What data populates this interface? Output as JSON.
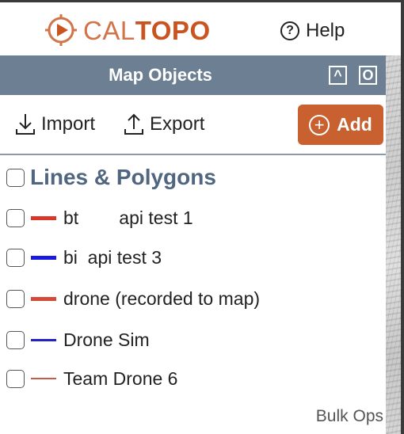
{
  "brand": {
    "logo_part1": "CAL",
    "logo_part2": "TOPO",
    "color_light": "#d2744a",
    "color_dark": "#c9541f"
  },
  "header": {
    "help_icon": "?",
    "help_label": "Help"
  },
  "panel": {
    "title": "Map Objects",
    "collapse_icon": "^",
    "popout_icon": "O"
  },
  "toolbar": {
    "import_label": "Import",
    "export_label": "Export",
    "add_icon": "+",
    "add_label": "Add",
    "add_color": "#c8612f"
  },
  "section": {
    "label": "Lines & Polygons"
  },
  "items": [
    {
      "label": "bt        api test 1",
      "color": "#d9372a",
      "weight": "thick"
    },
    {
      "label": "bi  api test 3",
      "color": "#1a1ae0",
      "weight": "thick"
    },
    {
      "label": "drone (recorded to map)",
      "color": "#d24a3a",
      "weight": "thick"
    },
    {
      "label": "Drone Sim",
      "color": "#2222c8",
      "weight": "medium"
    },
    {
      "label": "Team Drone 6",
      "color": "#c85a4a",
      "weight": "thin"
    }
  ],
  "bulk_ops_label": "Bulk Ops"
}
